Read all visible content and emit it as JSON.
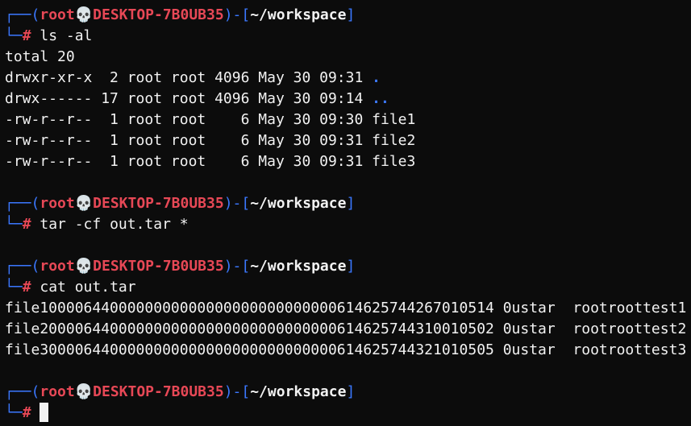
{
  "prompt": {
    "frame_top": "┌──(",
    "frame_bottom": "└─",
    "user": "root",
    "skull": "💀",
    "host": "DESKTOP-7B0UB35",
    "sep": ")-[",
    "path": "~/workspace",
    "close": "]",
    "hash": "#"
  },
  "blocks": [
    {
      "command": "ls -al",
      "output": [
        "total 20",
        "drwxr-xr-x  2 root root 4096 May 30 09:31 ",
        "drwx------ 17 root root 4096 May 30 09:14 ",
        "-rw-r--r--  1 root root    6 May 30 09:30 file1",
        "-rw-r--r--  1 root root    6 May 30 09:31 file2",
        "-rw-r--r--  1 root root    6 May 30 09:31 file3"
      ],
      "dir_names": [
        ".",
        ".."
      ]
    },
    {
      "command": "tar -cf out.tar *",
      "output": []
    },
    {
      "command": "cat out.tar",
      "output": [
        "file1000064400000000000000000000000000614625744267010514 0ustar  rootroottest1",
        "file2000064400000000000000000000000000614625744310010502 0ustar  rootroottest2",
        "file3000064400000000000000000000000000614625744321010505 0ustar  rootroottest3"
      ]
    },
    {
      "command": "",
      "output": []
    }
  ],
  "colors": {
    "background": "#0c0c0c",
    "frame": "#3b78ff",
    "user_host": "#e74856",
    "text": "#f2f2f2"
  }
}
